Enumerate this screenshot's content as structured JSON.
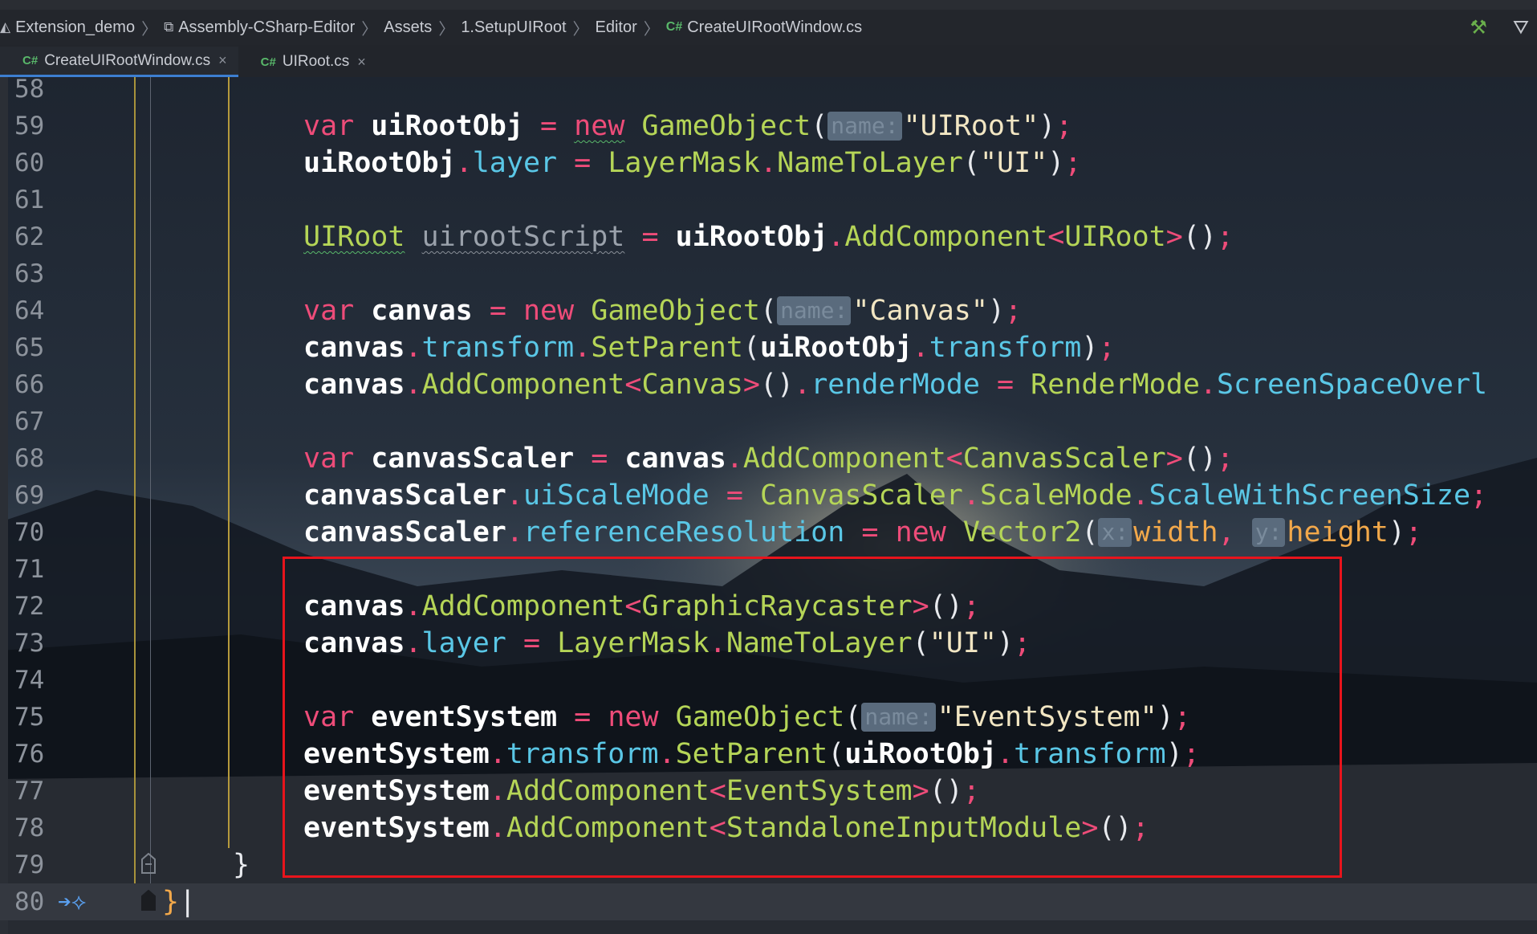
{
  "breadcrumb": {
    "items": [
      {
        "label": "Extension_demo",
        "icon": "unity-icon"
      },
      {
        "label": "Assembly-CSharp-Editor",
        "icon": "assembly-icon"
      },
      {
        "label": "Assets",
        "icon": ""
      },
      {
        "label": "1.SetupUIRoot",
        "icon": ""
      },
      {
        "label": "Editor",
        "icon": ""
      },
      {
        "label": "CreateUIRootWindow.cs",
        "icon": "csharp-icon"
      }
    ],
    "tools": [
      "hammer-icon",
      "debug-icon"
    ]
  },
  "tabs": [
    {
      "label": "CreateUIRootWindow.cs",
      "icon_text": "C#",
      "active": true
    },
    {
      "label": "UIRoot.cs",
      "icon_text": "C#",
      "active": false
    }
  ],
  "editor": {
    "line_numbers": [
      "58",
      "59",
      "60",
      "61",
      "62",
      "63",
      "64",
      "65",
      "66",
      "67",
      "68",
      "69",
      "70",
      "71",
      "72",
      "73",
      "74",
      "75",
      "76",
      "77",
      "78",
      "79",
      "80"
    ],
    "param_hint_name": "name:",
    "param_hint_x": "x:",
    "param_hint_y": "y:",
    "current_line": "80",
    "highlighted_region_lines": [
      "71",
      "79"
    ]
  },
  "colors": {
    "keyword": "#ee4c79",
    "method": "#b5d557",
    "property": "#5ac7e6",
    "string": "#f2e6c3",
    "highlight_box": "#e8141c",
    "tab_underline": "#3d7fd1"
  }
}
